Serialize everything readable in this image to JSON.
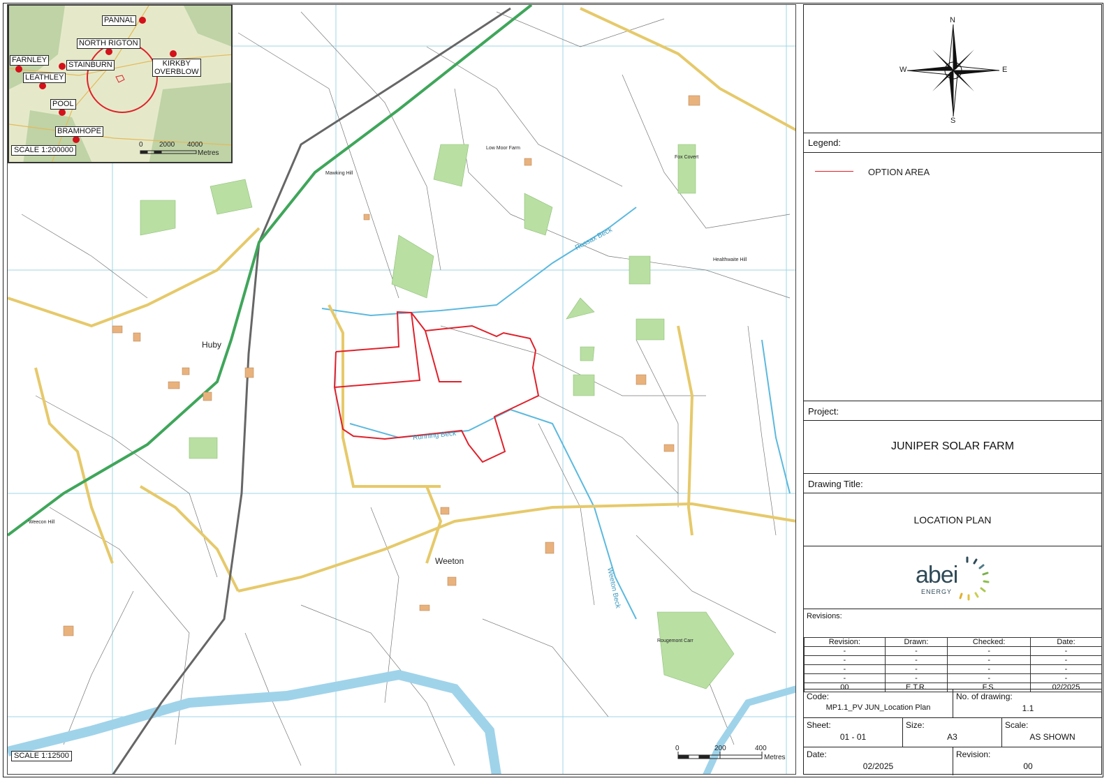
{
  "map": {
    "labels": {
      "huby": "Huby",
      "weeton": "Weeton",
      "running_beck": "Running Beck",
      "weeton_beck": "Weeton Beck",
      "rosebank_beck": "Rossax Beck",
      "healthwaite_hill": "Healthwaite Hill",
      "fox_covert": "Fox Covert",
      "low_moor_farm": "Low Moor Farm",
      "rougemont_carr": "Rougemont Carr",
      "weecon_hill": "Weecon Hill",
      "mawking_hill": "Mawking Hill"
    },
    "scale_text": "SCALE 1:12500",
    "scalebar": {
      "ticks": [
        "0",
        "200",
        "400"
      ],
      "unit": "Metres"
    }
  },
  "inset": {
    "towns": [
      "PANNAL",
      "NORTH RIGTON",
      "FARNLEY",
      "STAINBURN",
      "LEATHLEY",
      "POOL",
      "BRAMHOPE"
    ],
    "kirkby": [
      "KIRKBY",
      "OVERBLOW"
    ],
    "scale_text": "SCALE 1:200000",
    "scalebar": {
      "ticks": [
        "0",
        "2000",
        "4000"
      ],
      "unit": "Metres"
    }
  },
  "compass": {
    "n": "N",
    "s": "S",
    "e": "E",
    "w": "W"
  },
  "legend": {
    "title": "Legend:",
    "item_label": "OPTION AREA",
    "item_color": "#e0202a"
  },
  "project": {
    "title": "Project:",
    "value": "JUNIPER SOLAR  FARM"
  },
  "drawing": {
    "title": "Drawing Title:",
    "value": "LOCATION PLAN"
  },
  "logo": {
    "word": "abei",
    "sub": "ENERGY"
  },
  "revisions": {
    "title": "Revisions:",
    "headers": [
      "Revision:",
      "Drawn:",
      "Checked:",
      "Date:"
    ],
    "rows": [
      [
        "-",
        "-",
        "-",
        "-"
      ],
      [
        "-",
        "-",
        "-",
        "-"
      ],
      [
        "-",
        "-",
        "-",
        "-"
      ],
      [
        "-",
        "-",
        "-",
        "-"
      ],
      [
        "00",
        "E.T.R.",
        "F.S.",
        "02/2025"
      ]
    ]
  },
  "code": {
    "label": "Code:",
    "value": "MP1.1_PV JUN_Location Plan",
    "no_label": "No. of drawing:",
    "no_value": "1.1"
  },
  "sheet": {
    "label": "Sheet:",
    "value": "01 - 01",
    "size_label": "Size:",
    "size_value": "A3",
    "scale_label": "Scale:",
    "scale_value": "AS SHOWN"
  },
  "date": {
    "label": "Date:",
    "value": "02/2025",
    "rev_label": "Revision:",
    "rev_value": "00"
  }
}
